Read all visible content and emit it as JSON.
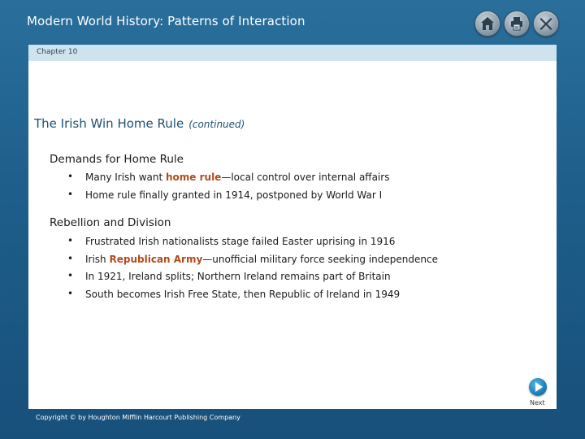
{
  "header": {
    "app_title": "Modern World History: Patterns of Interaction",
    "buttons": {
      "home_icon": "home-icon",
      "print_icon": "print-icon",
      "exit_icon": "close-icon"
    }
  },
  "chapter": {
    "label": "Chapter 10"
  },
  "slide": {
    "title": "The Irish Win Home Rule",
    "title_suffix": "(continued)",
    "sections": [
      {
        "heading": "Demands for Home Rule",
        "bullets": [
          {
            "before": "Many Irish want ",
            "highlight": "home rule",
            "after": "—local control over internal affairs"
          },
          {
            "before": "Home rule finally granted in 1914, postponed by World War I",
            "highlight": "",
            "after": ""
          }
        ]
      },
      {
        "heading": "Rebellion and Division",
        "bullets": [
          {
            "before": "Frustrated Irish nationalists stage failed Easter uprising in 1916",
            "highlight": "",
            "after": ""
          },
          {
            "before": "Irish ",
            "highlight": "Republican Army",
            "after": "—unofficial military force  seeking independence"
          },
          {
            "before": "In 1921, Ireland splits; Northern Ireland remains part of Britain",
            "highlight": "",
            "after": ""
          },
          {
            "before": "South becomes Irish Free State, then Republic of Ireland in 1949",
            "highlight": "",
            "after": ""
          }
        ]
      }
    ],
    "bullet_char": "•"
  },
  "footer": {
    "next_label": "Next",
    "copyright": "Copyright © by Houghton Mifflin Harcourt Publishing Company"
  },
  "colors": {
    "frame": "#1f5f8c",
    "chapter_bar": "#cfe3ee",
    "title": "#1c4f73",
    "highlight": "#b24b1d"
  }
}
